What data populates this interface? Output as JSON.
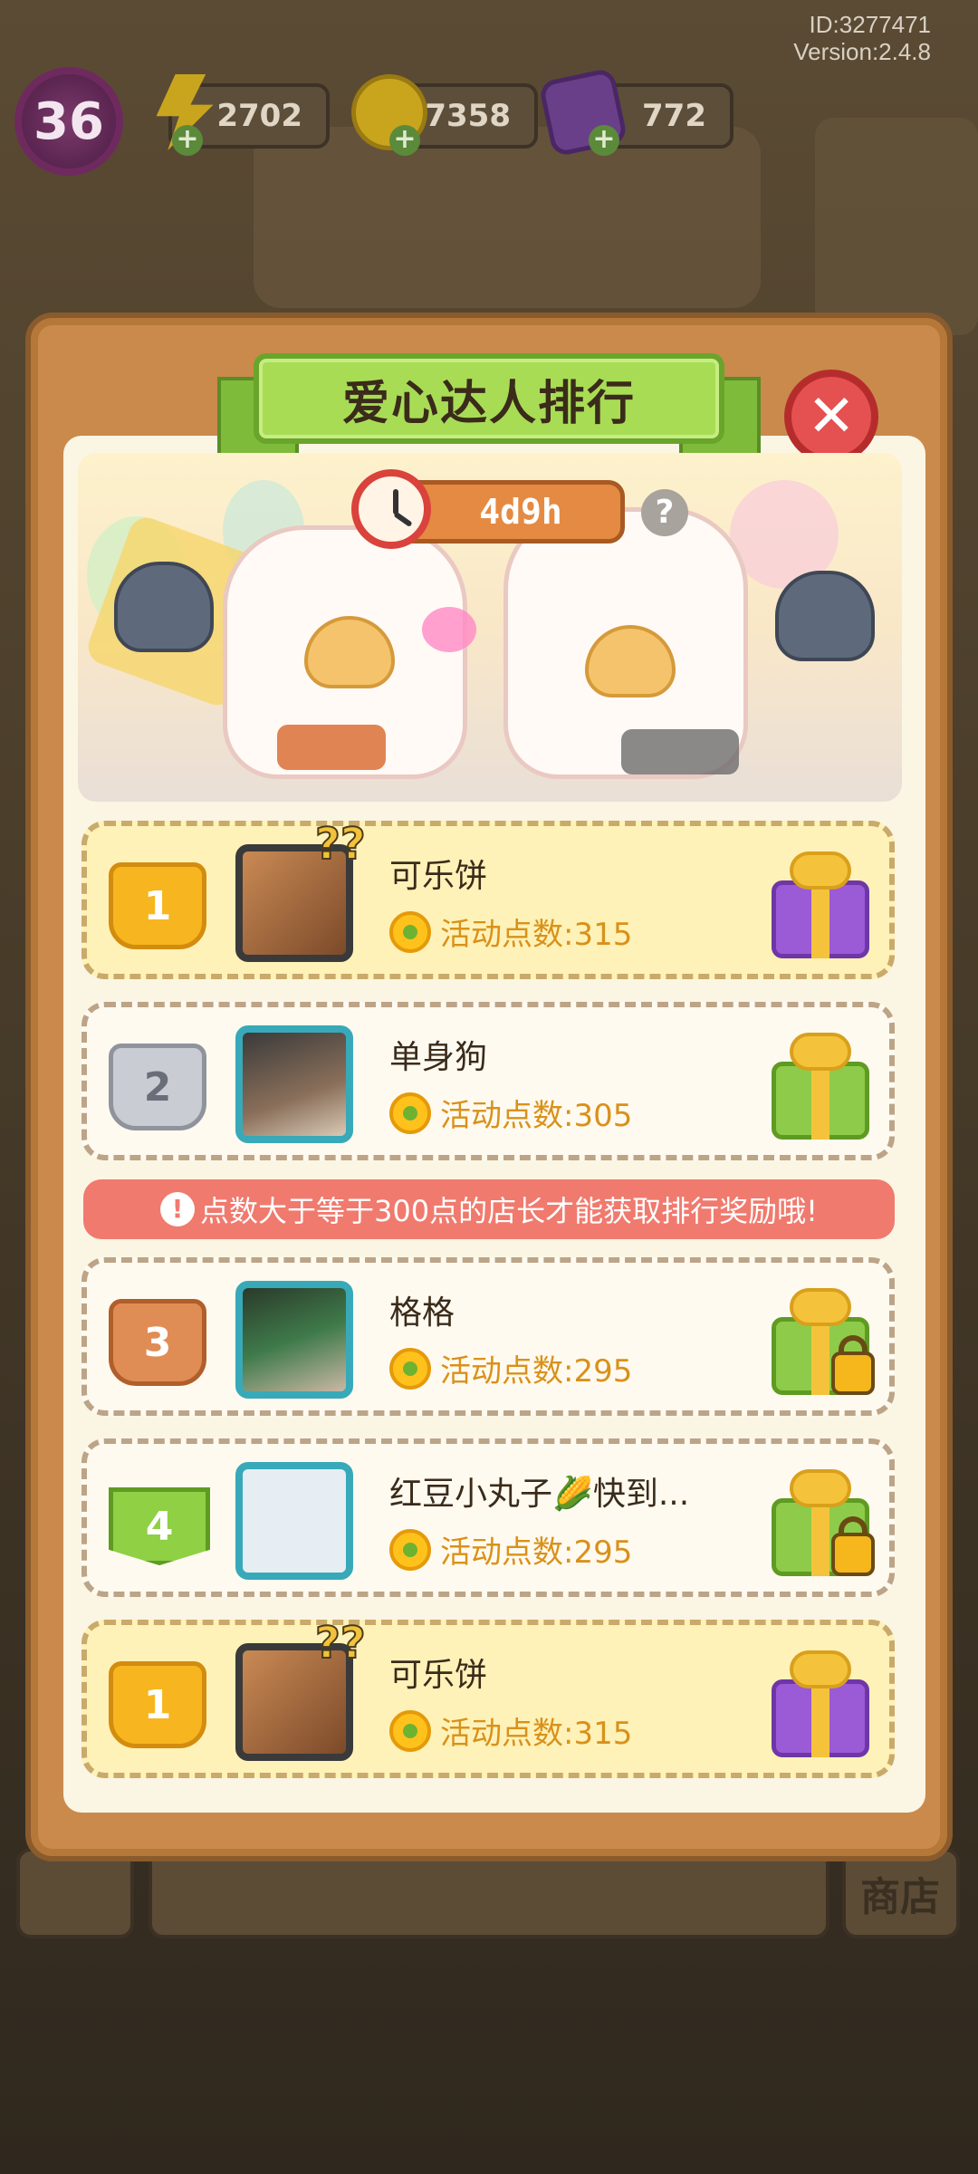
{
  "header": {
    "id_text": "ID:3277471",
    "version_text": "Version:2.4.8"
  },
  "hud": {
    "level": "36",
    "energy": "2702",
    "coins": "27358",
    "gems": "772"
  },
  "dialog": {
    "title": "爱心达人排行",
    "timer": "4d9h",
    "help": "?",
    "close": "✕",
    "notice": "点数大于等于300点的店长才能获取排行奖励哦!"
  },
  "ranking": [
    {
      "rank": "1",
      "name": "可乐饼",
      "points_label": "活动点数:315",
      "reward": "purple-gift",
      "locked": false
    },
    {
      "rank": "2",
      "name": "单身狗",
      "points_label": "活动点数:305",
      "reward": "green-gift",
      "locked": false
    },
    {
      "rank": "3",
      "name": "格格",
      "points_label": "活动点数:295",
      "reward": "green-gift",
      "locked": true
    },
    {
      "rank": "4",
      "name": "红豆小丸子🌽快到...",
      "points_label": "活动点数:295",
      "reward": "green-gift",
      "locked": true
    }
  ],
  "my_rank": {
    "rank": "1",
    "name": "可乐饼",
    "points_label": "活动点数:315",
    "reward": "purple-gift"
  },
  "bottom": {
    "shop": "商店"
  },
  "colors": {
    "panel": "#c98a4c",
    "ribbon": "#a8dc55",
    "close": "#e55050",
    "notice": "#f07a6e",
    "points": "#d9911a",
    "gold_row": "#fff2b8"
  }
}
